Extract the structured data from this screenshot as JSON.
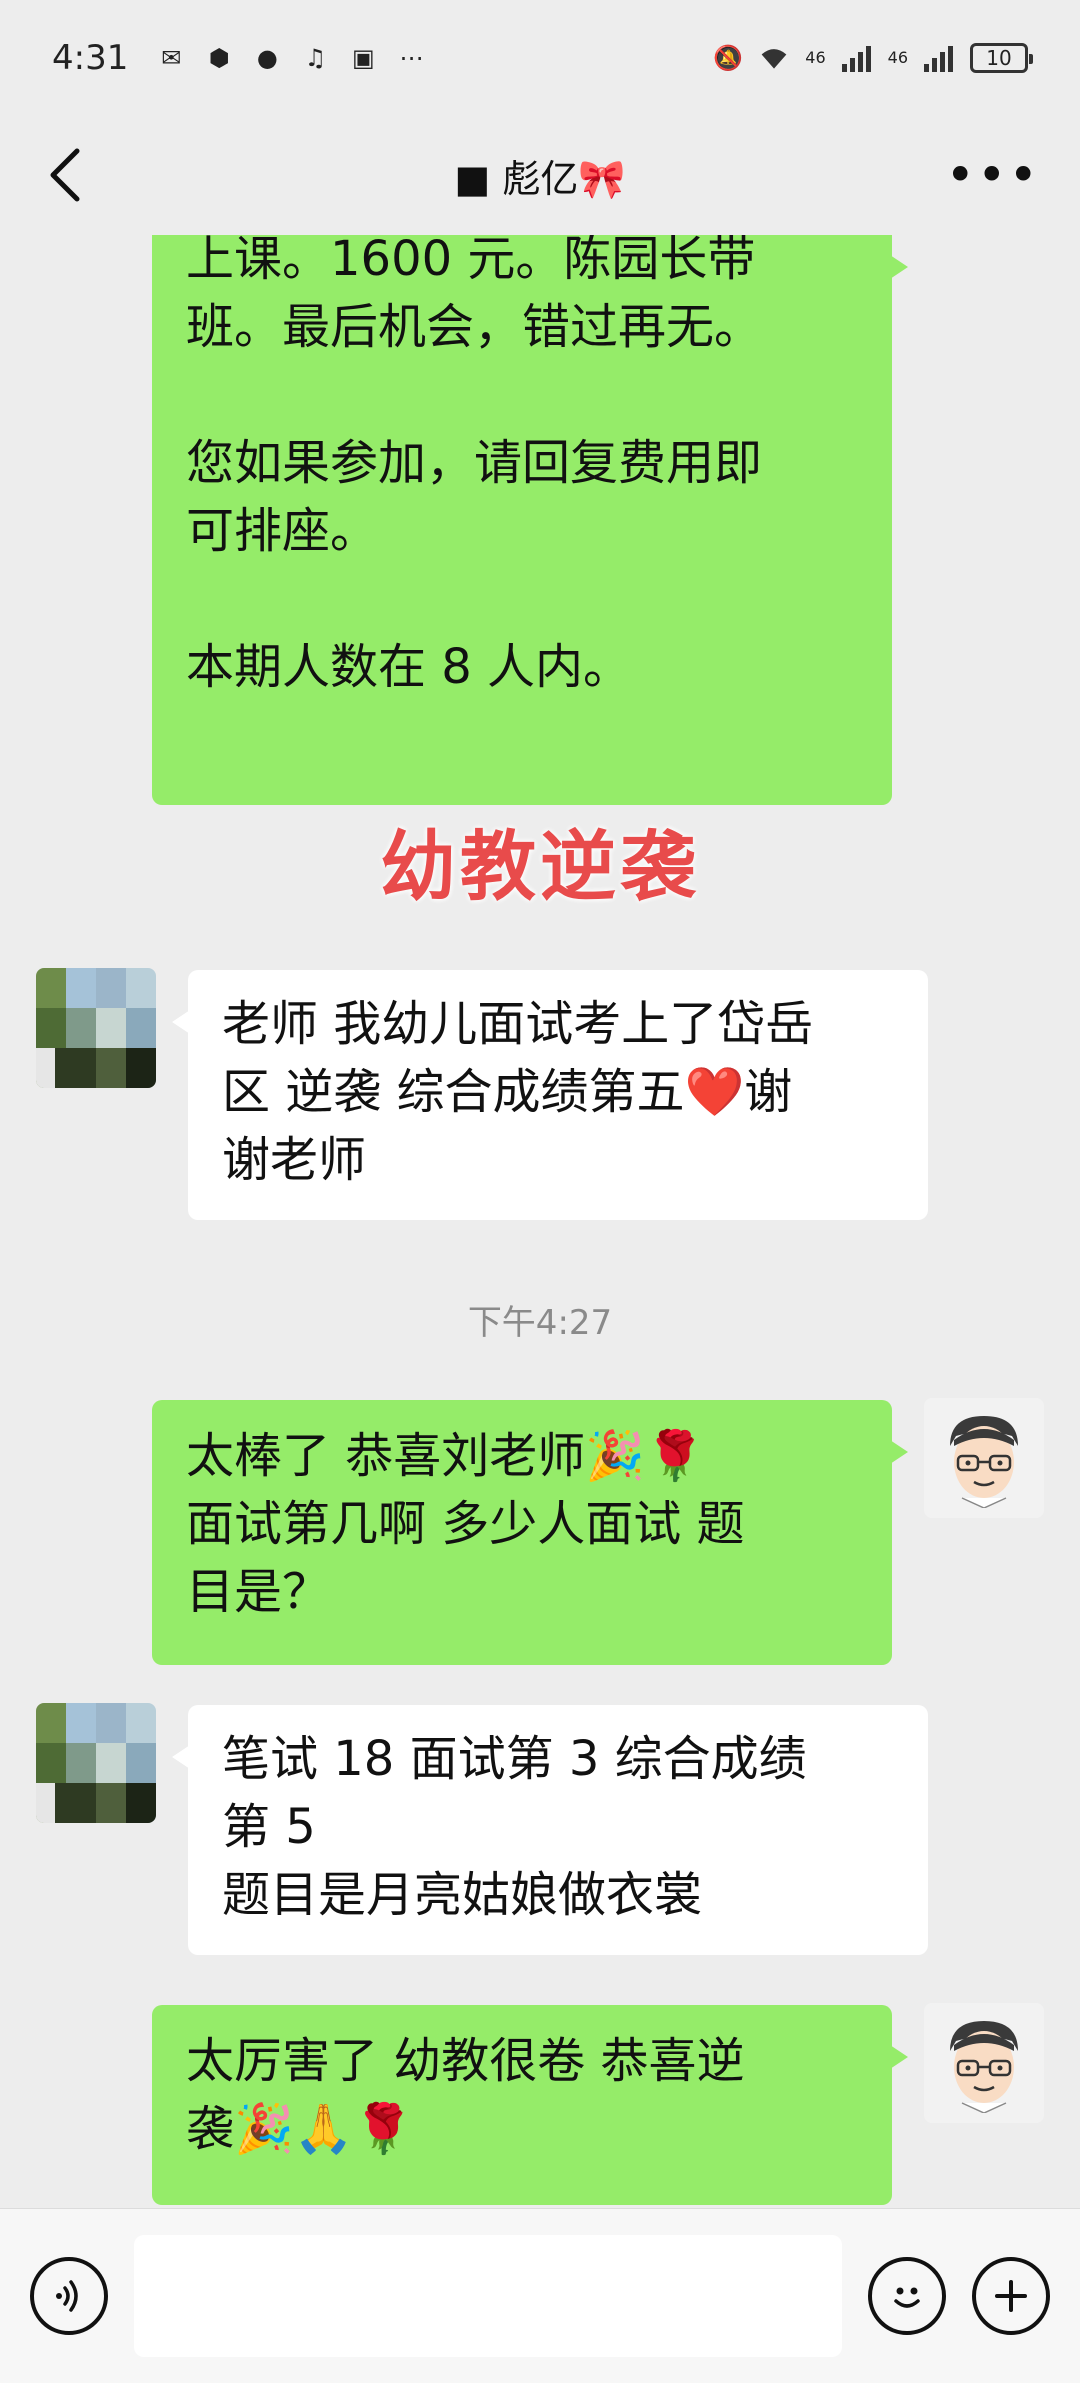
{
  "status_bar": {
    "time": "4:31",
    "battery": "10",
    "network_1": "46",
    "network_2": "46"
  },
  "nav": {
    "back_icon": "chevron-left-icon",
    "title": "■ 彪亿🎀",
    "more_icon": "more-dots-icon"
  },
  "messages": [
    {
      "side": "me",
      "text": "上课。1600 元。陈园长带\n班。最后机会，错过再无。\n\n您如果参加，请回复费用即\n可排座。\n\n本期人数在 8 人内。"
    },
    {
      "side": "overlay",
      "text": "幼教逆袭"
    },
    {
      "side": "them",
      "text": "老师 我幼儿面试考上了岱岳\n区 逆袭 综合成绩第五❤️谢\n谢老师"
    },
    {
      "side": "time",
      "text": "下午4:27"
    },
    {
      "side": "me",
      "text": "太棒了 恭喜刘老师🎉🌹\n面试第几啊 多少人面试 题\n目是？"
    },
    {
      "side": "them",
      "text": "笔试 18 面试第 3 综合成绩\n第 5\n题目是月亮姑娘做衣裳"
    },
    {
      "side": "me",
      "text": "太厉害了 幼教很卷 恭喜逆\n袭🎉🙏🌹"
    }
  ],
  "input_bar": {
    "voice_icon": "voice-icon",
    "emoji_icon": "emoji-icon",
    "plus_icon": "plus-icon"
  },
  "colors": {
    "my_bubble": "#95ec69",
    "their_bubble": "#ffffff",
    "background": "#ededed",
    "overlay_text": "#e84b4b"
  }
}
